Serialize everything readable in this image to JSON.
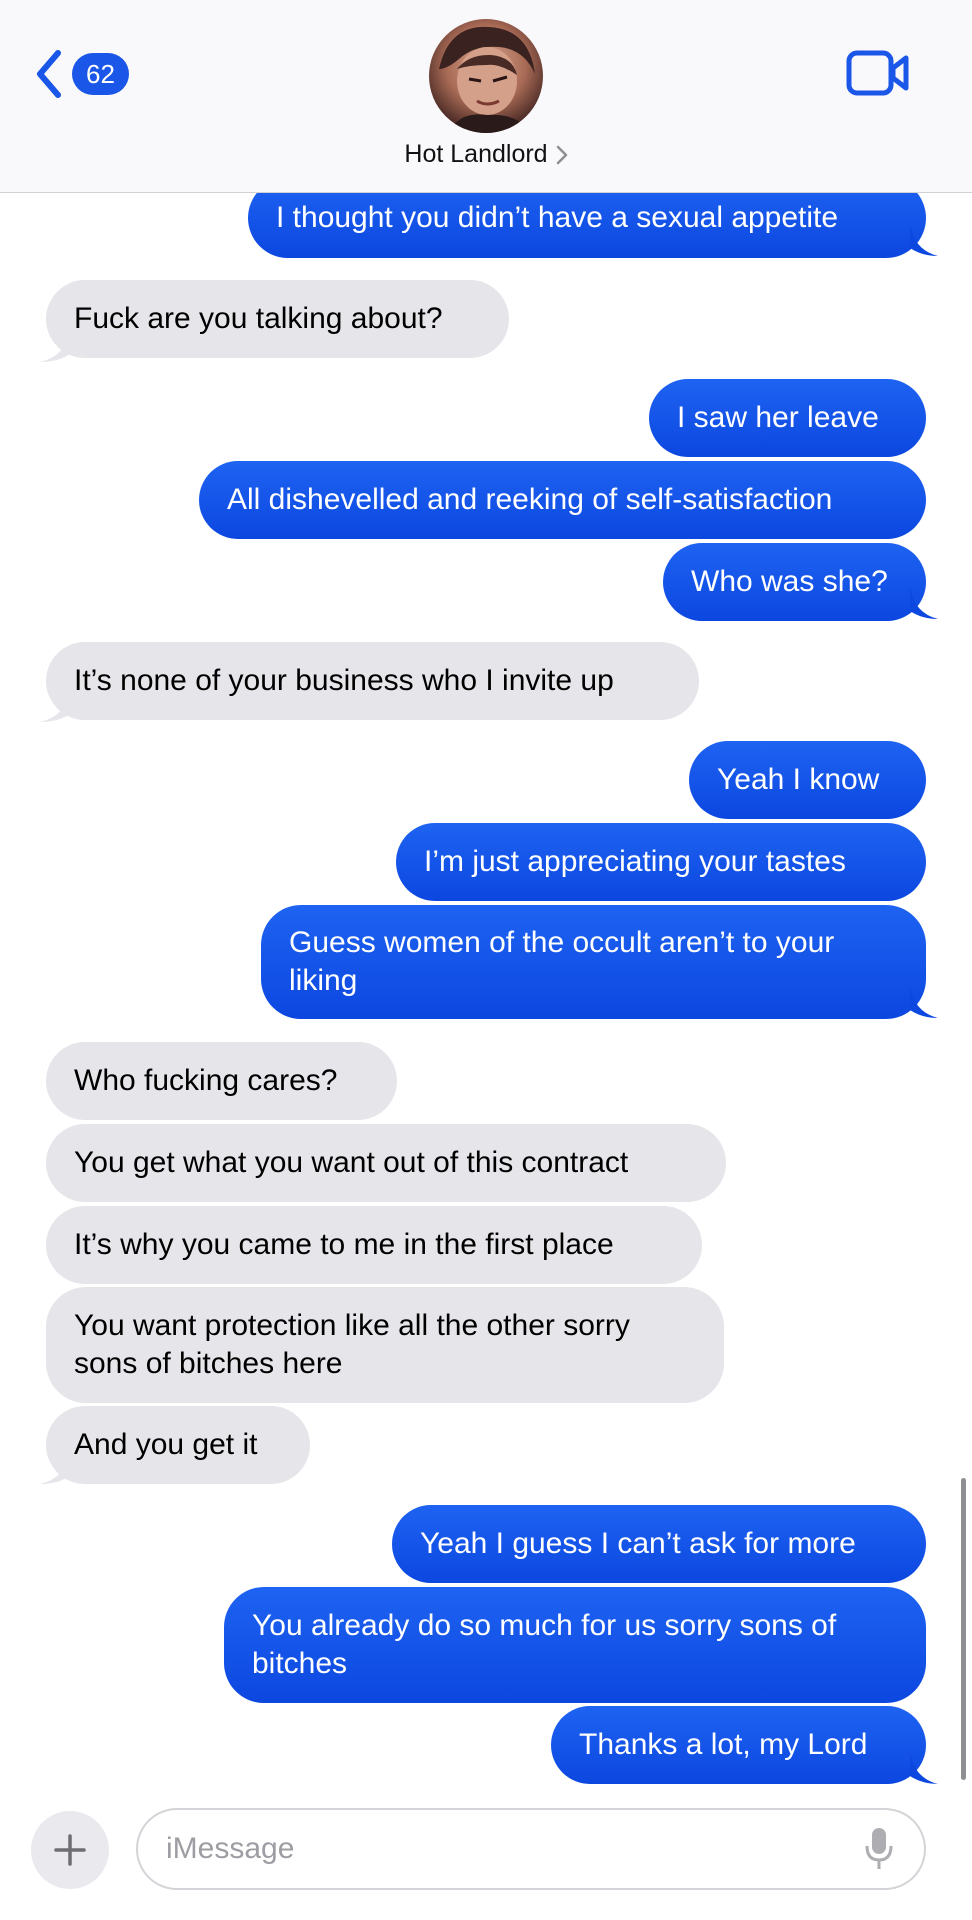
{
  "header": {
    "back_badge": "62",
    "contact_name": "Hot Landlord"
  },
  "messages": [
    {
      "side": "sent",
      "text": "I thought you didn’t have a sexual appetite"
    },
    {
      "side": "recv",
      "text": "Fuck are you talking about?"
    },
    {
      "side": "sent",
      "text": "I saw her leave"
    },
    {
      "side": "sent",
      "text": "All dishevelled and reeking of self-satisfaction"
    },
    {
      "side": "sent",
      "text": "Who was she?"
    },
    {
      "side": "recv",
      "text": "It’s none of your business who I invite up"
    },
    {
      "side": "sent",
      "text": "Yeah I know"
    },
    {
      "side": "sent",
      "text": "I’m just appreciating your tastes"
    },
    {
      "side": "sent",
      "text": "Guess women of the occult aren’t to your liking"
    },
    {
      "side": "recv",
      "text": "Who fucking cares?"
    },
    {
      "side": "recv",
      "text": "You get what you want out of this contract"
    },
    {
      "side": "recv",
      "text": "It’s why you came to me in the first place"
    },
    {
      "side": "recv",
      "text": "You want protection like all the other sorry sons of bitches here"
    },
    {
      "side": "recv",
      "text": "And you get it"
    },
    {
      "side": "sent",
      "text": "Yeah I guess I can’t ask for more"
    },
    {
      "side": "sent",
      "text": "You already do so much for us sorry sons of bitches"
    },
    {
      "side": "sent",
      "text": "Thanks a lot, my Lord"
    }
  ],
  "composer": {
    "placeholder": "iMessage"
  },
  "colors": {
    "sent_bubble": "#1a56e8",
    "received_bubble": "#e5e5ea",
    "accent": "#1a56e8"
  },
  "icons": {
    "back": "chevron-left-icon",
    "video": "video-camera-icon",
    "plus": "plus-icon",
    "mic": "microphone-icon",
    "name_chevron": "chevron-right-icon"
  }
}
